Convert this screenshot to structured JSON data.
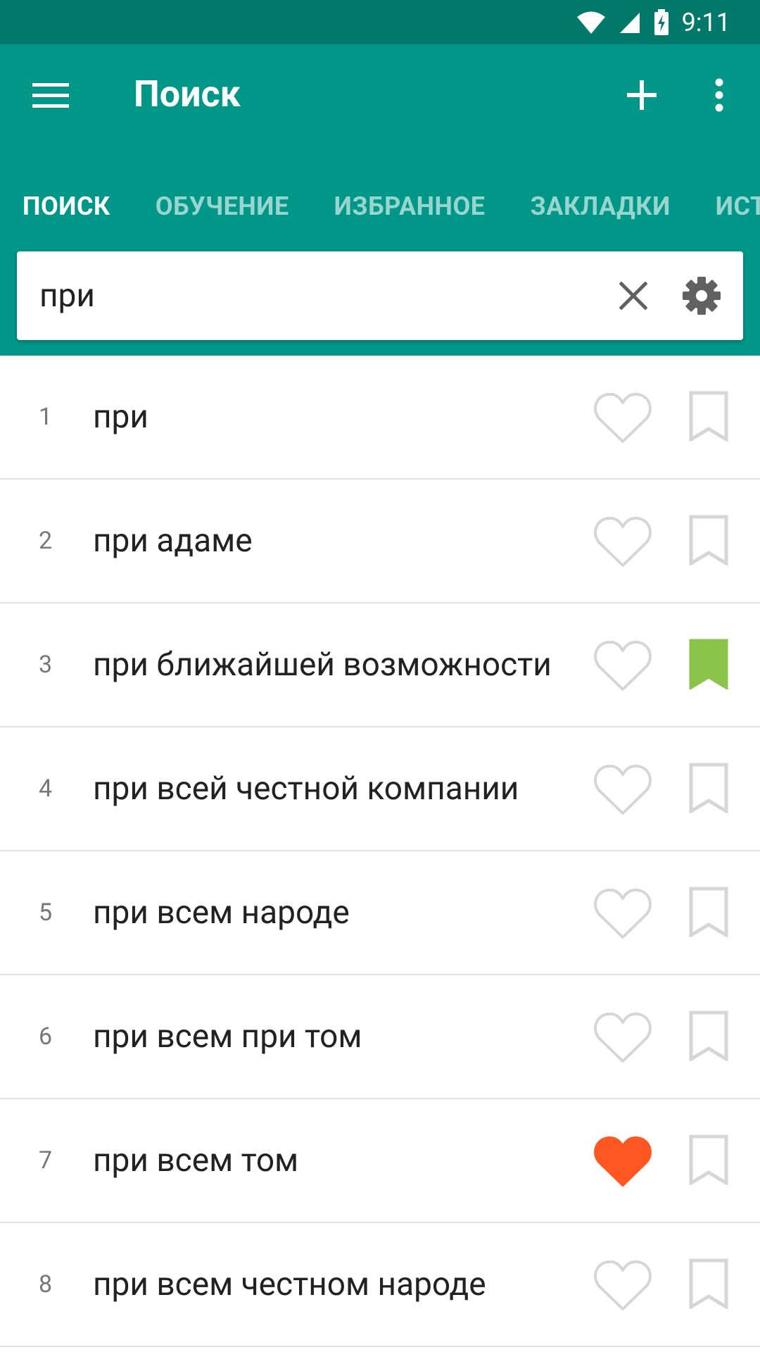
{
  "status_bar": {
    "time": "9:11"
  },
  "app_bar": {
    "title": "Поиск"
  },
  "tabs": [
    "ПОИСК",
    "ОБУЧЕНИЕ",
    "ИЗБРАННОЕ",
    "ЗАКЛАДКИ",
    "ИСТОРИЯ"
  ],
  "search": {
    "value": "при"
  },
  "results": [
    {
      "num": "1",
      "text": "при",
      "favorite": false,
      "bookmarked": false
    },
    {
      "num": "2",
      "text": "при адаме",
      "favorite": false,
      "bookmarked": false
    },
    {
      "num": "3",
      "text": "при ближайшей возможности",
      "favorite": false,
      "bookmarked": true
    },
    {
      "num": "4",
      "text": "при всей честной компании",
      "favorite": false,
      "bookmarked": false
    },
    {
      "num": "5",
      "text": "при всем народе",
      "favorite": false,
      "bookmarked": false
    },
    {
      "num": "6",
      "text": "при всем при том",
      "favorite": false,
      "bookmarked": false
    },
    {
      "num": "7",
      "text": "при всем том",
      "favorite": true,
      "bookmarked": false
    },
    {
      "num": "8",
      "text": "при всем честном народе",
      "favorite": false,
      "bookmarked": false
    }
  ],
  "colors": {
    "primary": "#009688",
    "status_bar": "#00796b",
    "favorite_active": "#ff5722",
    "bookmark_active": "#8bc34a",
    "icon_inactive": "#d6d6d6"
  },
  "icons": {
    "menu": "menu-icon",
    "add": "plus-icon",
    "more": "more-vert-icon",
    "clear": "close-icon",
    "settings": "gear-icon",
    "favorite": "heart-icon",
    "bookmark": "bookmark-icon"
  }
}
